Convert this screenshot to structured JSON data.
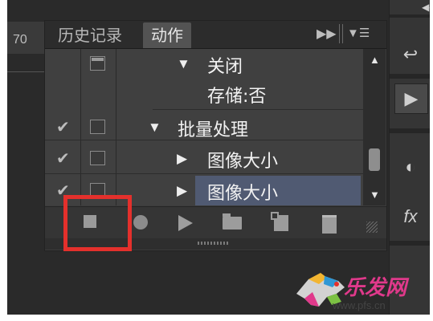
{
  "ruler": {
    "value": "70"
  },
  "panel": {
    "tabs": [
      {
        "label": "历史记录",
        "active": false
      },
      {
        "label": "动作",
        "active": true
      }
    ],
    "collapse_icon": "double-chevron-right-icon",
    "menu_icon": "panel-menu-icon",
    "rows": [
      {
        "checked": false,
        "dialog": "filled",
        "expanded": true,
        "label": "关闭"
      },
      {
        "checked": false,
        "dialog": "none",
        "expanded": null,
        "label": "存储:否"
      },
      {
        "checked": true,
        "dialog": "empty",
        "expanded": true,
        "label": "批量处理"
      },
      {
        "checked": true,
        "dialog": "empty",
        "expanded": false,
        "label": "图像大小"
      },
      {
        "checked": true,
        "dialog": "empty",
        "expanded": false,
        "label": "图像大小",
        "selected": true
      }
    ],
    "toolbar": [
      "stop-recording-icon",
      "record-icon",
      "play-icon",
      "new-set-folder-icon",
      "new-action-icon",
      "delete-icon"
    ],
    "highlight_color": "#e4302c",
    "selection_color": "#505a72"
  },
  "dock": {
    "items": [
      "history-icon",
      "actions-play-icon",
      "brush-preset-icon",
      "fx-icon"
    ]
  },
  "watermark": {
    "text": "乐发网",
    "url": "www.pfs.cn"
  }
}
